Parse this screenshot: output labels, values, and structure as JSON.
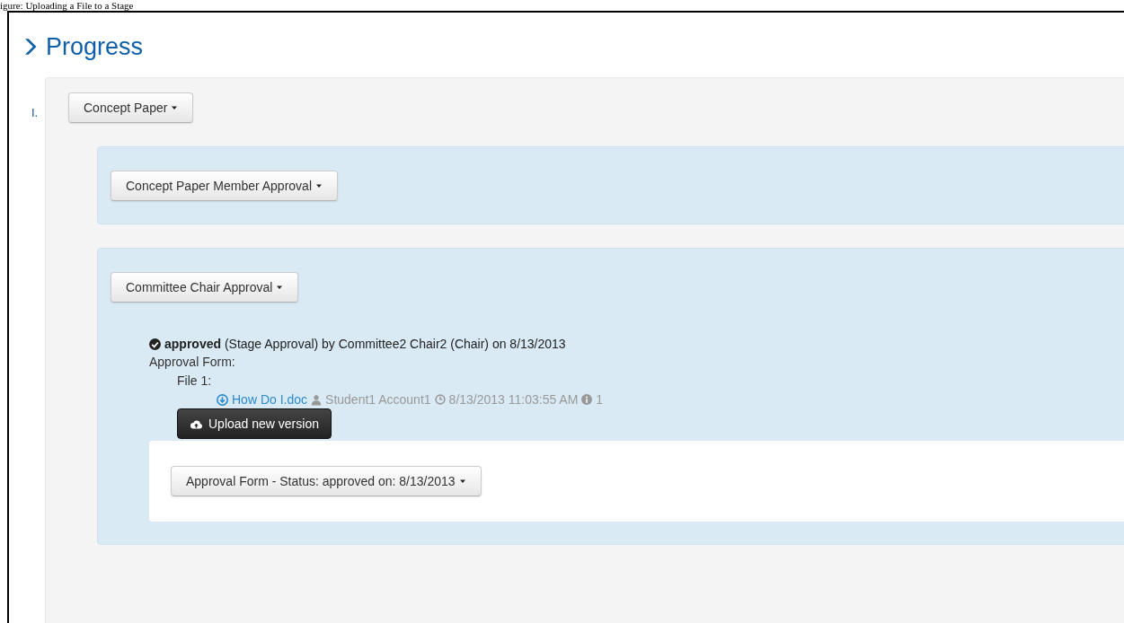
{
  "caption": "igure: Uploading a File to a Stage",
  "title": "Progress",
  "stages": [
    {
      "number": "I.",
      "label": "Concept Paper",
      "steps": [
        {
          "label": "Concept Paper Member Approval"
        },
        {
          "label": "Committee Chair Approval",
          "approval": {
            "text": "**approved** (Stage Approval) by Committee2 Chair2 (Chair) on 8/13/2013",
            "form_label": "Approval Form:",
            "files": [
              {
                "label": "File 1:",
                "name": "How Do I.doc",
                "user": "Student1 Account1",
                "time": "8/13/2013 11:03:55 AM",
                "count": "1"
              }
            ],
            "upload_button": "Upload new version",
            "form_status": "Approval Form - Status: approved on: 8/13/2013"
          }
        }
      ]
    }
  ]
}
